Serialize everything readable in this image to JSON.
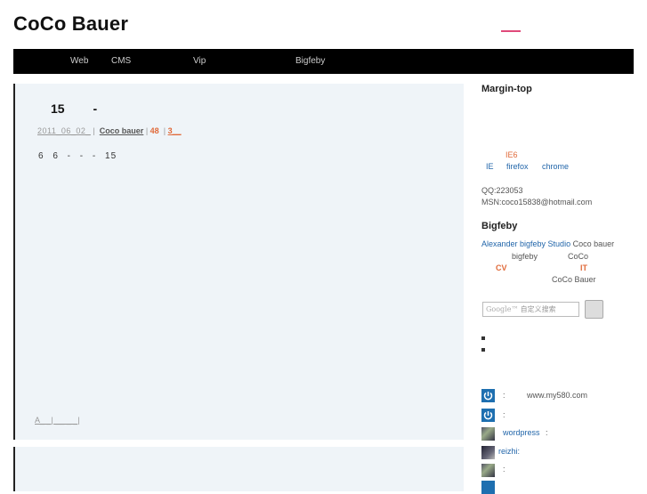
{
  "header": {
    "title": "CoCo Bauer"
  },
  "nav": {
    "items": [
      "Web",
      "CMS",
      "Vip",
      "Bigfeby"
    ]
  },
  "post": {
    "title": "15 -",
    "date": "2011_06_02_",
    "sep1": "|",
    "author": "Coco bauer",
    "count": "48",
    "sep2": "|",
    "comments": "3__",
    "excerpt": "6 6 - - - 15",
    "footer": "A_ _| __ _ _|"
  },
  "sidebar": {
    "margin_heading": "Margin-top",
    "ie6": "IE6",
    "browsers": [
      "IE",
      "firefox",
      "chrome"
    ],
    "qq": "QQ:223053",
    "msn": "MSN:coco15838@hotmail.com",
    "bigfeby_heading": "Bigfeby",
    "about": {
      "studio_link": "Alexander bigfeby Studio",
      "author": "Coco bauer",
      "bigfeby": "bigfeby",
      "coco": "CoCo",
      "cv": "CV",
      "it": "IT",
      "full_name": "CoCo Bauer"
    },
    "search": {
      "logo": "Google™",
      "placeholder": "自定义搜索"
    },
    "recent_comments": [
      {
        "icon": "power-icon",
        "name": ":",
        "text": "www.my580.com"
      },
      {
        "icon": "power-icon",
        "name": ":",
        "text": ""
      },
      {
        "icon": "photo-avatar",
        "name": "wordpress",
        "text": ":"
      },
      {
        "icon": "dark-avatar",
        "name": "reizhi:",
        "text": ""
      },
      {
        "icon": "photo-avatar",
        "name": ":",
        "text": ""
      }
    ]
  },
  "colors": {
    "accent": "#e04a7a",
    "link": "#2266aa",
    "highlight": "#e06a3a",
    "post_bg": "#eff4f8",
    "nav_bg": "#000000"
  }
}
